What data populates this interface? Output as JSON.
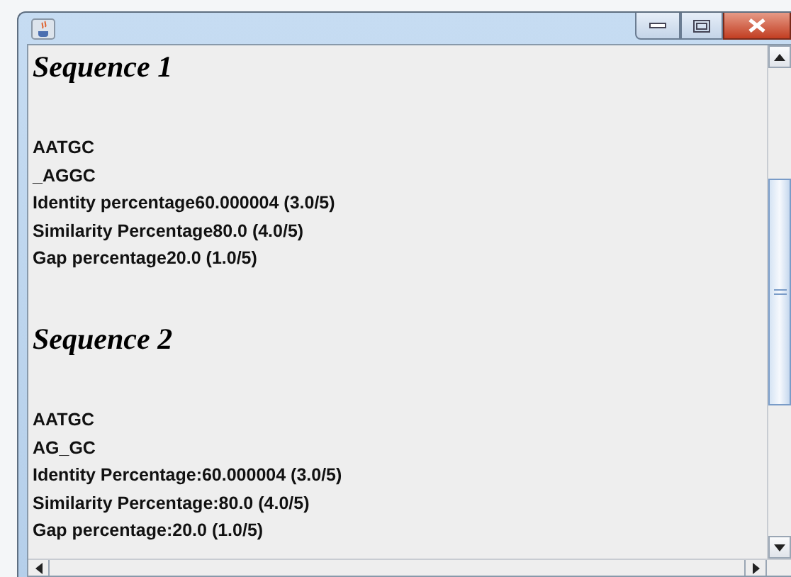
{
  "sections": [
    {
      "heading": "Sequence 1",
      "lines": [
        "AATGC",
        "_AGGC",
        "Identity percentage60.000004 (3.0/5)",
        "Similarity Percentage80.0 (4.0/5)",
        "Gap percentage20.0 (1.0/5)"
      ]
    },
    {
      "heading": "Sequence 2",
      "lines": [
        "AATGC",
        "AG_GC",
        "Identity Percentage:60.000004 (3.0/5)",
        "Similarity Percentage:80.0 (4.0/5)",
        "Gap percentage:20.0 (1.0/5)"
      ]
    }
  ]
}
